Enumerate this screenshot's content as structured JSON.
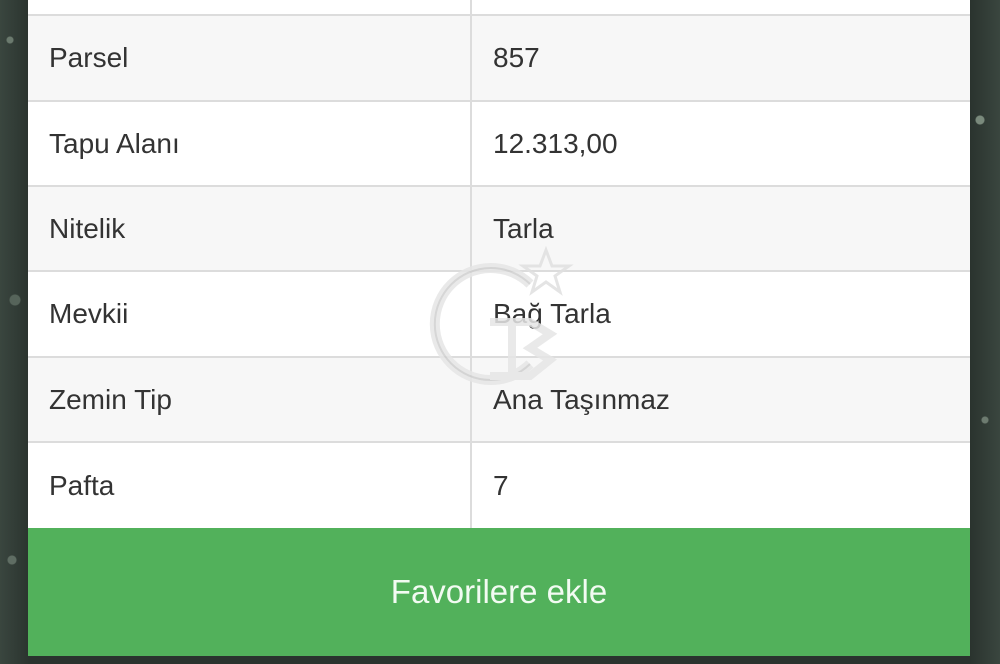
{
  "table": {
    "rows": [
      {
        "label": "",
        "value": ""
      },
      {
        "label": "Parsel",
        "value": "857"
      },
      {
        "label": "Tapu Alanı",
        "value": "12.313,00"
      },
      {
        "label": "Nitelik",
        "value": "Tarla"
      },
      {
        "label": "Mevkii",
        "value": "Bağ Tarla"
      },
      {
        "label": "Zemin Tip",
        "value": "Ana Taşınmaz"
      },
      {
        "label": "Pafta",
        "value": "7"
      }
    ]
  },
  "actions": {
    "favorite_label": "Favorilere ekle"
  },
  "colors": {
    "button": "#52b15b",
    "row_alt": "#f7f7f7",
    "divider": "#dcdcdc"
  },
  "icons": {
    "watermark": "coldwell-banker-logo-icon"
  }
}
